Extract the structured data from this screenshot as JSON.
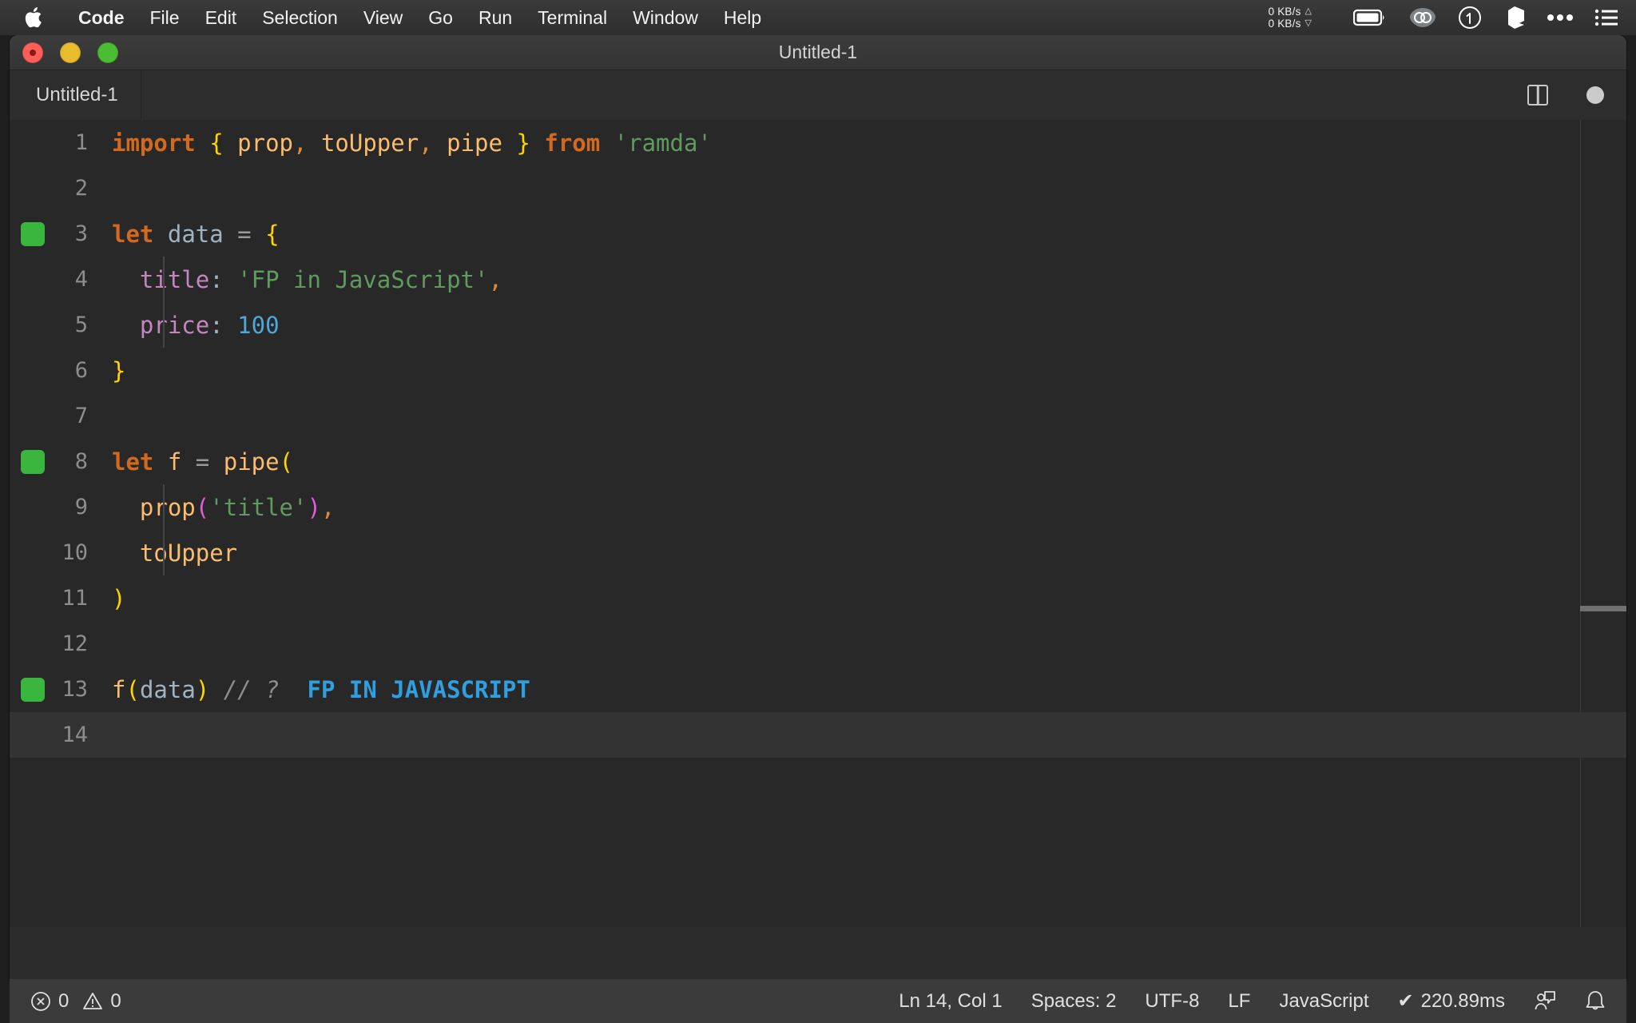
{
  "menubar": {
    "apple_icon": "apple-logo-icon",
    "items": [
      {
        "label": "Code",
        "bold": true
      },
      {
        "label": "File",
        "bold": false
      },
      {
        "label": "Edit",
        "bold": false
      },
      {
        "label": "Selection",
        "bold": false
      },
      {
        "label": "View",
        "bold": false
      },
      {
        "label": "Go",
        "bold": false
      },
      {
        "label": "Run",
        "bold": false
      },
      {
        "label": "Terminal",
        "bold": false
      },
      {
        "label": "Window",
        "bold": false
      },
      {
        "label": "Help",
        "bold": false
      }
    ],
    "status": {
      "net_up": "0 KB/s",
      "net_down": "0 KB/s",
      "arrow_up": "△",
      "arrow_down": "▽",
      "icons": [
        "battery-icon",
        "eye-cloud-icon",
        "clock-icon",
        "cube-icon",
        "ellipsis-icon",
        "control-center-list-icon"
      ]
    }
  },
  "window": {
    "title": "Untitled-1",
    "traffic_lights": [
      "close-button",
      "minimize-button",
      "maximize-button"
    ]
  },
  "tabbar": {
    "tab_label": "Untitled-1",
    "actions": [
      "split-editor-icon",
      "unsaved-dot-icon"
    ]
  },
  "editor": {
    "current_line": 14,
    "language": "JavaScript",
    "lines": [
      {
        "n": "1",
        "marked": false,
        "indent": false,
        "tokens": [
          {
            "t": "import",
            "c": "kw"
          },
          {
            "t": " ",
            "c": "plain"
          },
          {
            "t": "{",
            "c": "br1"
          },
          {
            "t": " ",
            "c": "plain"
          },
          {
            "t": "prop",
            "c": "ident"
          },
          {
            "t": ",",
            "c": "punc"
          },
          {
            "t": " ",
            "c": "plain"
          },
          {
            "t": "toUpper",
            "c": "ident"
          },
          {
            "t": ",",
            "c": "punc"
          },
          {
            "t": " ",
            "c": "plain"
          },
          {
            "t": "pipe",
            "c": "ident"
          },
          {
            "t": " ",
            "c": "plain"
          },
          {
            "t": "}",
            "c": "br1"
          },
          {
            "t": " ",
            "c": "plain"
          },
          {
            "t": "from",
            "c": "kw"
          },
          {
            "t": " ",
            "c": "plain"
          },
          {
            "t": "'ramda'",
            "c": "str"
          }
        ]
      },
      {
        "n": "2",
        "marked": false,
        "indent": false,
        "tokens": []
      },
      {
        "n": "3",
        "marked": true,
        "indent": false,
        "tokens": [
          {
            "t": "let",
            "c": "kw"
          },
          {
            "t": " ",
            "c": "plain"
          },
          {
            "t": "data",
            "c": "var"
          },
          {
            "t": " ",
            "c": "plain"
          },
          {
            "t": "=",
            "c": "op"
          },
          {
            "t": " ",
            "c": "plain"
          },
          {
            "t": "{",
            "c": "br1"
          }
        ]
      },
      {
        "n": "4",
        "marked": false,
        "indent": true,
        "tokens": [
          {
            "t": "  ",
            "c": "plain"
          },
          {
            "t": "title",
            "c": "prop"
          },
          {
            "t": ":",
            "c": "colon"
          },
          {
            "t": " ",
            "c": "plain"
          },
          {
            "t": "'FP in JavaScript'",
            "c": "str"
          },
          {
            "t": ",",
            "c": "punc"
          }
        ]
      },
      {
        "n": "5",
        "marked": false,
        "indent": true,
        "tokens": [
          {
            "t": "  ",
            "c": "plain"
          },
          {
            "t": "price",
            "c": "prop"
          },
          {
            "t": ":",
            "c": "colon"
          },
          {
            "t": " ",
            "c": "plain"
          },
          {
            "t": "100",
            "c": "num"
          }
        ]
      },
      {
        "n": "6",
        "marked": false,
        "indent": false,
        "tokens": [
          {
            "t": "}",
            "c": "br1"
          }
        ]
      },
      {
        "n": "7",
        "marked": false,
        "indent": false,
        "tokens": []
      },
      {
        "n": "8",
        "marked": true,
        "indent": false,
        "tokens": [
          {
            "t": "let",
            "c": "kw"
          },
          {
            "t": " ",
            "c": "plain"
          },
          {
            "t": "f",
            "c": "ident"
          },
          {
            "t": " ",
            "c": "plain"
          },
          {
            "t": "=",
            "c": "op"
          },
          {
            "t": " ",
            "c": "plain"
          },
          {
            "t": "pipe",
            "c": "ident"
          },
          {
            "t": "(",
            "c": "br1"
          }
        ]
      },
      {
        "n": "9",
        "marked": false,
        "indent": true,
        "tokens": [
          {
            "t": "  ",
            "c": "plain"
          },
          {
            "t": "prop",
            "c": "ident"
          },
          {
            "t": "(",
            "c": "br2"
          },
          {
            "t": "'title'",
            "c": "str"
          },
          {
            "t": ")",
            "c": "br2"
          },
          {
            "t": ",",
            "c": "punc"
          }
        ]
      },
      {
        "n": "10",
        "marked": false,
        "indent": true,
        "tokens": [
          {
            "t": "  ",
            "c": "plain"
          },
          {
            "t": "toUpper",
            "c": "ident"
          }
        ]
      },
      {
        "n": "11",
        "marked": false,
        "indent": false,
        "tokens": [
          {
            "t": ")",
            "c": "br1"
          }
        ]
      },
      {
        "n": "12",
        "marked": false,
        "indent": false,
        "tokens": []
      },
      {
        "n": "13",
        "marked": true,
        "indent": false,
        "tokens": [
          {
            "t": "f",
            "c": "ident"
          },
          {
            "t": "(",
            "c": "br1"
          },
          {
            "t": "data",
            "c": "var"
          },
          {
            "t": ")",
            "c": "br1"
          },
          {
            "t": " ",
            "c": "plain"
          },
          {
            "t": "// ?",
            "c": "comment"
          },
          {
            "t": "  ",
            "c": "plain"
          },
          {
            "t": "FP IN JAVASCRIPT",
            "c": "result"
          }
        ]
      },
      {
        "n": "14",
        "marked": false,
        "indent": false,
        "tokens": []
      }
    ]
  },
  "statusbar": {
    "errors": "0",
    "warnings": "0",
    "cursor": "Ln 14, Col 1",
    "spaces": "Spaces: 2",
    "encoding": "UTF-8",
    "eol": "LF",
    "language": "JavaScript",
    "quokka_check": "✔",
    "quokka_time": "220.89ms",
    "right_icons": [
      "feedback-icon",
      "bell-icon"
    ]
  },
  "colors": {
    "editor_bg": "#282828",
    "current_line": "#333333",
    "status_bar_bg": "#3b3b3b",
    "gutter_added": "#3ab53e",
    "result_blue": "#2f9fe0",
    "keyword_orange": "#d2691e",
    "string_green": "#5f9a5f"
  }
}
